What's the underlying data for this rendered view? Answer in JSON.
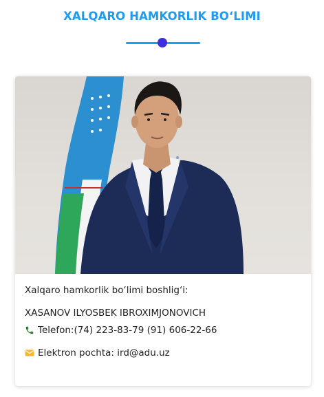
{
  "section": {
    "title": "XALQARO HAMKORLIK BO‘LIMI"
  },
  "colors": {
    "accent": "#1e9cf0",
    "dot": "#3b2fe0",
    "phone_icon": "#2e7d32",
    "email_icon": "#f5b82e"
  },
  "card": {
    "photo_icon": "person-portrait",
    "position": "Xalqaro hamkorlik bo‘limi boshlig‘i:",
    "name": "XASANOV ILYOSBEK IBROXIMJONOVICH",
    "phone": {
      "icon": "phone-icon",
      "label": "Telefon:",
      "value": "(74) 223-83-79 (91) 606-22-66"
    },
    "email": {
      "icon": "envelope-icon",
      "label": "Elektron pochta:",
      "value": "ird@adu.uz"
    }
  }
}
